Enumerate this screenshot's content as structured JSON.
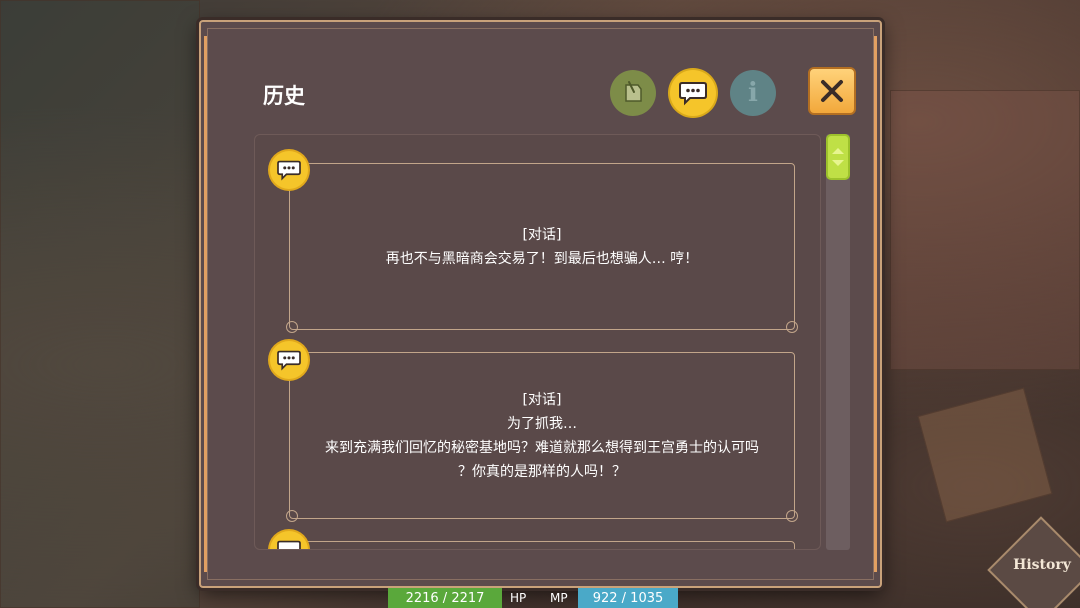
{
  "panel": {
    "title": "历史",
    "tools": {
      "note_icon": "note-icon",
      "dialog_icon": "speech-bubble-icon",
      "info_icon": "info-icon",
      "info_glyph": "i",
      "close_icon": "close-icon"
    }
  },
  "history": {
    "entries": [
      {
        "tag": "[对话]",
        "lines": [
          "再也不与黑暗商会交易了！到最后也想骗人… 哼！"
        ]
      },
      {
        "tag": "[对话]",
        "lines": [
          "为了抓我…",
          "来到充满我们回忆的秘密基地吗？难道就那么想得到王宫勇士的认可吗",
          "？你真的是那样的人吗！？"
        ]
      }
    ]
  },
  "status": {
    "hp_value": "2216 / 2217",
    "hp_label": "HP",
    "mp_label": "MP",
    "mp_value": "922 / 1035"
  },
  "history_button": {
    "label": "History"
  },
  "colors": {
    "accent_yellow": "#f5c52a",
    "scroll_green": "#bfe046",
    "hp_green": "#5aa83b",
    "mp_blue": "#4aa9c8"
  }
}
